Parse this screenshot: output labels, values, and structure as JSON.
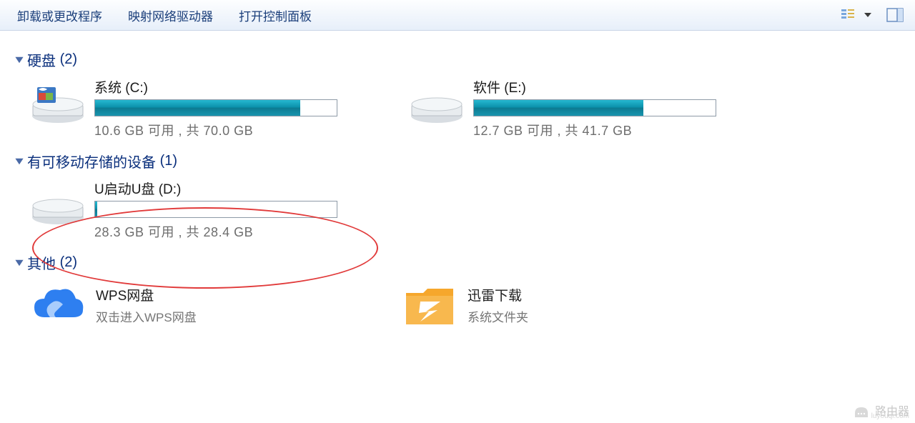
{
  "toolbar": {
    "uninstall": "卸载或更改程序",
    "map_drive": "映射网络驱动器",
    "control_panel": "打开控制面板"
  },
  "groups": {
    "hdd": {
      "label": "硬盘",
      "count": "(2)"
    },
    "removable": {
      "label": "有可移动存储的设备",
      "count": "(1)"
    },
    "other": {
      "label": "其他",
      "count": "(2)"
    }
  },
  "drives": {
    "c": {
      "name": "系统 (C:)",
      "stats": "10.6 GB 可用 , 共 70.0 GB",
      "fill_pct": 85
    },
    "e": {
      "name": "软件 (E:)",
      "stats": "12.7 GB 可用 , 共 41.7 GB",
      "fill_pct": 70
    },
    "d": {
      "name": "U启动U盘 (D:)",
      "stats": "28.3 GB 可用 , 共 28.4 GB",
      "fill_pct": 1
    }
  },
  "other_items": {
    "wps": {
      "name": "WPS网盘",
      "sub": "双击进入WPS网盘"
    },
    "xunlei": {
      "name": "迅雷下载",
      "sub": "系统文件夹"
    }
  },
  "watermark": {
    "text": "路由器",
    "sub": "luyouqi.com"
  }
}
